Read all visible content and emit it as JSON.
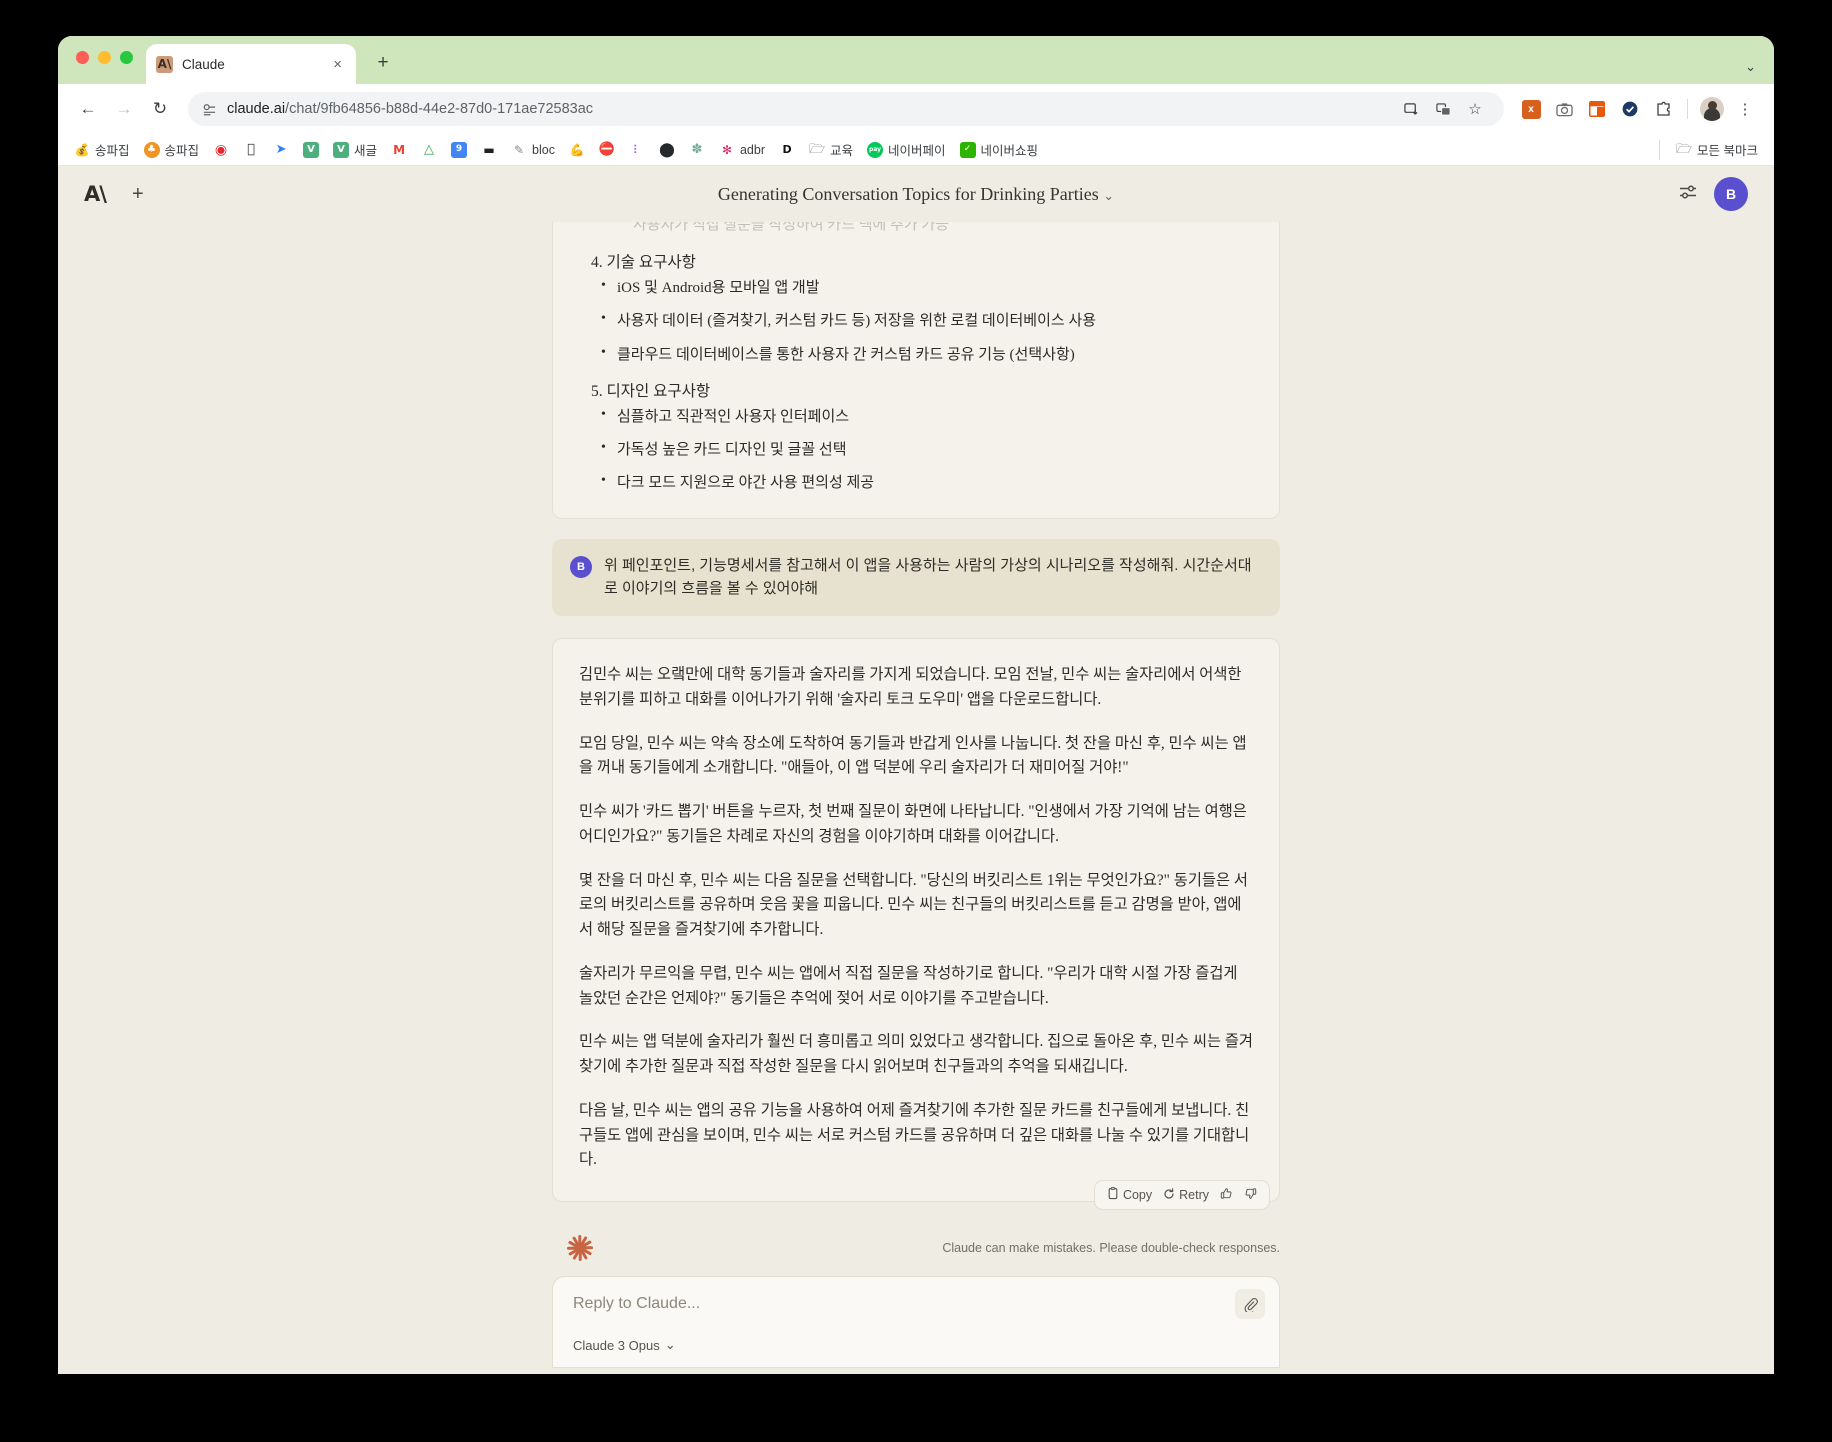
{
  "browser": {
    "tab": {
      "title": "Claude",
      "favicon": "anthropic-logo-icon",
      "close": "×"
    },
    "new_tab": "+",
    "tabstrip_caret": "⌄",
    "nav": {
      "back": "←",
      "forward": "→",
      "reload": "↻"
    },
    "omnibox": {
      "site_info_icon": "permission-icon",
      "url_host": "claude.ai",
      "url_path": "/chat/9fb64856-b88d-44e2-87d0-171ae72583ac",
      "install_icon": "install-app-icon",
      "translate_icon": "translate-icon",
      "bookmark_icon": "☆"
    },
    "extensions": [
      {
        "name": "excel-extension-icon",
        "label": "x",
        "color": "#d8601f"
      },
      {
        "name": "camera-extension-icon",
        "label": "📷",
        "color": "#6b6b6b"
      },
      {
        "name": "layout-extension-icon",
        "label": "▣",
        "color": "#e8590c"
      },
      {
        "name": "check-extension-icon",
        "label": "✓",
        "color": "#1f3864"
      },
      {
        "name": "puzzle-extension-icon",
        "label": "⬚",
        "color": "#3c4043"
      }
    ],
    "menu_icon": "⋮",
    "bookmarks": [
      {
        "label": "송파집",
        "icon": "💰",
        "color": "#e8b84b"
      },
      {
        "label": "송파집",
        "icon": "♣",
        "color": "#f29422"
      },
      {
        "label": "",
        "icon": "◉",
        "color": "#e8252a"
      },
      {
        "label": "",
        "icon": "",
        "color": "#333333"
      },
      {
        "label": "",
        "icon": "➤",
        "color": "#2d7ff9"
      },
      {
        "label": "",
        "icon": "V",
        "color": "#4caf7d"
      },
      {
        "label": "새글",
        "icon": "V",
        "color": "#4caf7d"
      },
      {
        "label": "",
        "icon": "M",
        "color": "#ea4335"
      },
      {
        "label": "",
        "icon": "△",
        "color": "#34a853"
      },
      {
        "label": "",
        "icon": "9",
        "color": "#4285f4"
      },
      {
        "label": "",
        "icon": "▬",
        "color": "#222222"
      },
      {
        "label": "bloc",
        "icon": "✒",
        "color": "#888888"
      },
      {
        "label": "",
        "icon": "💪",
        "color": "#e8b84b"
      },
      {
        "label": "",
        "icon": "⛔",
        "color": "#d93025"
      },
      {
        "label": "",
        "icon": "✇",
        "color": "#a259ff"
      },
      {
        "label": "",
        "icon": "⬤",
        "color": "#24292e"
      },
      {
        "label": "",
        "icon": "✽",
        "color": "#74aa9c"
      },
      {
        "label": "adbr",
        "icon": "✻",
        "color": "#e01e5a"
      },
      {
        "label": "",
        "icon": "D",
        "color": "#111111"
      },
      {
        "label": "교육",
        "icon": "🗀",
        "color": "#5f6368"
      },
      {
        "label": "네이버페이",
        "icon": "pay",
        "color": "#03c75a"
      },
      {
        "label": "네이버쇼핑",
        "icon": "🛒",
        "color": "#2db400"
      }
    ],
    "all_bookmarks": {
      "label": "모든 북마크",
      "icon": "🗀"
    }
  },
  "app": {
    "logo": "A\\",
    "new_chat": "+",
    "chat_title": "Generating Conversation Topics for Drinking Parties",
    "chat_title_caret": "⌄",
    "settings_icon": "sliders-icon",
    "user_initial": "B"
  },
  "prev_message": {
    "faded_bullet": "사용자가 직접 질문을 작성하여 카드 덱에 추가 가능",
    "sections": [
      {
        "number": "4.",
        "heading": "기술 요구사항",
        "items": [
          "iOS 및 Android용 모바일 앱 개발",
          "사용자 데이터 (즐겨찾기, 커스텀 카드 등) 저장을 위한 로컬 데이터베이스 사용",
          "클라우드 데이터베이스를 통한 사용자 간 커스텀 카드 공유 기능 (선택사항)"
        ]
      },
      {
        "number": "5.",
        "heading": "디자인 요구사항",
        "items": [
          "심플하고 직관적인 사용자 인터페이스",
          "가독성 높은 카드 디자인 및 글꼴 선택",
          "다크 모드 지원으로 야간 사용 편의성 제공"
        ]
      }
    ]
  },
  "user_message": {
    "initial": "B",
    "text": "위 페인포인트, 기능명세서를 참고해서 이 앱을 사용하는 사람의 가상의 시나리오를 작성해줘. 시간순서대로 이야기의 흐름을 볼 수 있어야해"
  },
  "assistant_message": {
    "paragraphs": [
      "김민수 씨는 오랰만에 대학 동기들과 술자리를 가지게 되었습니다. 모임 전날, 민수 씨는 술자리에서 어색한 분위기를 피하고 대화를 이어나가기 위해 '술자리 토크 도우미' 앱을 다운로드합니다.",
      "모임 당일, 민수 씨는 약속 장소에 도착하여 동기들과 반갑게 인사를 나눕니다. 첫 잔을 마신 후, 민수 씨는 앱을 꺼내 동기들에게 소개합니다. \"애들아, 이 앱 덕분에 우리 술자리가 더 재미어질 거야!\"",
      "민수 씨가 '카드 뽑기' 버튼을 누르자, 첫 번째 질문이 화면에 나타납니다. \"인생에서 가장 기억에 남는 여행은 어디인가요?\" 동기들은 차례로 자신의 경험을 이야기하며 대화를 이어갑니다.",
      "몇 잔을 더 마신 후, 민수 씨는 다음 질문을 선택합니다. \"당신의 버킷리스트 1위는 무엇인가요?\" 동기들은 서로의 버킷리스트를 공유하며 웃음 꽃을 피웁니다. 민수 씨는 친구들의 버킷리스트를 듣고 감명을 받아, 앱에서 해당 질문을 즐겨찾기에 추가합니다.",
      "술자리가 무르익을 무렵, 민수 씨는 앱에서 직접 질문을 작성하기로 합니다. \"우리가 대학 시절 가장 즐겁게 놀았던 순간은 언제야?\" 동기들은 추억에 젖어 서로 이야기를 주고받습니다.",
      "민수 씨는 앱 덕분에 술자리가 훨씬 더 흥미롭고 의미 있었다고 생각합니다. 집으로 돌아온 후, 민수 씨는 즐겨찾기에 추가한 질문과 직접 작성한 질문을 다시 읽어보며 친구들과의 추억을 되새깁니다.",
      "다음 날, 민수 씨는 앱의 공유 기능을 사용하여 어제 즐겨찾기에 추가한 질문 카드를 친구들에게 보냅니다. 친구들도 앱에 관심을 보이며, 민수 씨는 서로 커스텀 카드를 공유하며 더 깊은 대화를 나눌 수 있기를 기대합니다."
    ]
  },
  "actions": {
    "copy_icon": "⎘",
    "copy_label": "Copy",
    "retry_icon": "↺",
    "retry_label": "Retry",
    "thumbs_up_icon": "👍",
    "thumbs_down_icon": "👎"
  },
  "footer": {
    "logo": "sunburst-icon",
    "disclaimer": "Claude can make mistakes. Please double-check responses."
  },
  "composer": {
    "placeholder": "Reply to Claude...",
    "attach_icon": "📎",
    "model": "Claude 3 Opus",
    "model_caret": "⌄"
  },
  "colors": {
    "accent": "#c96442",
    "avatar": "#5a4fcf",
    "app_bg": "#eeece3",
    "card_bg": "#f4f2ea",
    "user_bubble": "#e7e2cf",
    "tabstrip": "#cfe5bb"
  }
}
